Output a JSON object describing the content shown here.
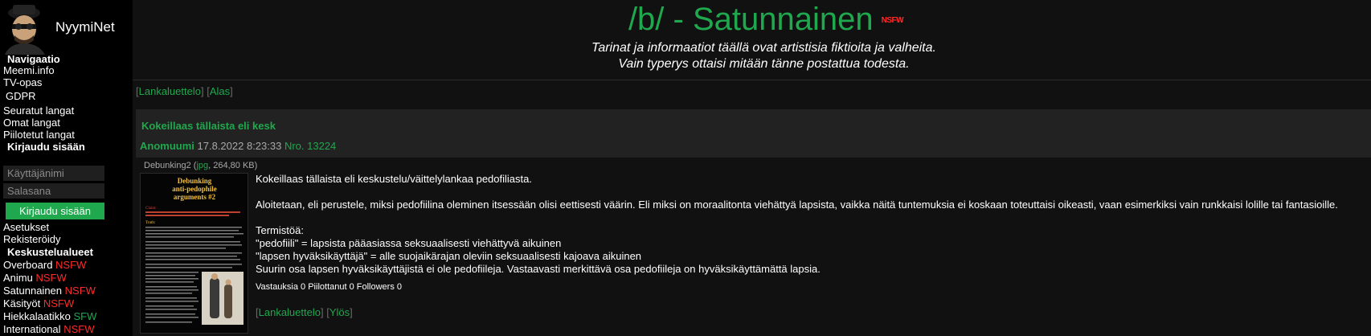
{
  "site": {
    "name": "NyymiNet"
  },
  "sidebar": {
    "nav_heading": "Navigaatio",
    "nav_links": [
      "Meemi.info",
      "TV-opas",
      "GDPR",
      "Seuratut langat",
      "Omat langat",
      "Piilotetut langat"
    ],
    "login_heading": "Kirjaudu sisään",
    "username_placeholder": "Käyttäjänimi",
    "password_placeholder": "Salasana",
    "login_button": "Kirjaudu sisään",
    "misc_links": [
      "Asetukset",
      "Rekisteröidy"
    ],
    "boards_heading": "Keskustelualueet",
    "boards": [
      {
        "name": "Overboard",
        "rating": "NSFW"
      },
      {
        "name": "Animu",
        "rating": "NSFW"
      },
      {
        "name": "Satunnainen",
        "rating": "NSFW"
      },
      {
        "name": "Käsityöt",
        "rating": "NSFW"
      },
      {
        "name": "Hiekkalaatikko",
        "rating": "SFW"
      },
      {
        "name": "International",
        "rating": "NSFW"
      }
    ]
  },
  "header": {
    "title": "/b/ - Satunnainen",
    "badge": "NSFW",
    "subtitle_line1": "Tarinat ja informaatiot täällä ovat artistisia fiktioita ja valheita.",
    "subtitle_line2": "Vain typerys ottaisi mitään tänne postattua todesta."
  },
  "top_nav": {
    "catalog": "Lankaluettelo",
    "down": "Alas"
  },
  "thread": {
    "subject": "Kokeillaas tällaista eli kesk",
    "poster": "Anomuumi",
    "date": "17.8.2022 8:23:33",
    "post_no": "Nro. 13224",
    "file": {
      "name": "Debunking2",
      "ext": "jpg",
      "size": "264,80 KB"
    },
    "thumb": {
      "title_line1": "Debunking",
      "title_line2": "anti-pedophile",
      "title_line3": "arguments #2",
      "claim_label": "Claim:",
      "truth_label": "Truth:"
    },
    "body": [
      "Kokeillaas tällaista eli keskustelu/väittelylankaa pedofiliasta.",
      "",
      "Aloitetaan, eli perustele, miksi pedofiilina oleminen itsessään olisi eettisesti väärin. Eli miksi on moraalitonta viehättyä lapsista, vaikka näitä tuntemuksia ei koskaan toteuttaisi oikeasti, vaan esimerkiksi vain runkkaisi lolille tai fantasioille.",
      "",
      "Termistöä:",
      "\"pedofiili\" = lapsista pääasiassa seksuaalisesti viehättyvä aikuinen",
      "\"lapsen hyväksikäyttäjä\" = alle suojaikärajan oleviin seksuaalisesti kajoava aikuinen",
      "Suurin osa lapsen hyväksikäyttäjistä ei ole pedofiileja. Vastaavasti merkittävä osa pedofiileja on hyväksikäyttämättä lapsia."
    ],
    "stats": "Vastauksia 0 Piilottanut 0 Followers 0",
    "bottom_nav": {
      "catalog": "Lankaluettelo",
      "up": "Ylös"
    }
  },
  "colors": {
    "accent_green": "#1fa84d",
    "nsfw_red": "#ff2a2a",
    "background": "#111111",
    "sidebar": "#000000",
    "thread_bar": "#222222"
  }
}
